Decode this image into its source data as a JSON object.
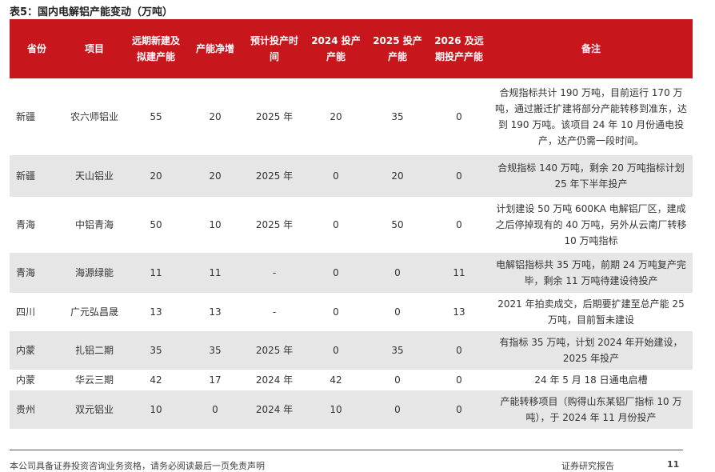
{
  "title": "表5：国内电解铝产能变动（万吨）",
  "headers": [
    "省份",
    "项目",
    "远期新建及拟建产能",
    "产能净增",
    "预计投产时间",
    "2024 投产产能",
    "2025 投产产能",
    "2026 及远期投产产能",
    "备注"
  ],
  "rows": [
    [
      "新疆",
      "农六师铝业",
      "55",
      "20",
      "2025 年",
      "20",
      "35",
      "0",
      "合规指标共计 190 万吨，目前运行 170 万吨，通过搬迁扩建将部分产能转移到准东，达到 190 万吨。该项目 24 年 10 月份通电投产，达产仍需一段时间。"
    ],
    [
      "新疆",
      "天山铝业",
      "20",
      "20",
      "2025 年",
      "0",
      "20",
      "0",
      "合规指标 140 万吨，剩余 20 万吨指标计划 25 年下半年投产"
    ],
    [
      "青海",
      "中铝青海",
      "50",
      "10",
      "2025 年",
      "0",
      "50",
      "0",
      "计划建设 50 万吨 600KA 电解铝厂区，建成之后停掉现有的 40 万吨，另外从云南厂转移 10 万吨指标"
    ],
    [
      "青海",
      "海源绿能",
      "11",
      "11",
      "-",
      "0",
      "0",
      "11",
      "电解铝指标共 35 万吨，前期 24 万吨复产完毕，剩余 11 万吨待建设待投产"
    ],
    [
      "四川",
      "广元弘昌晟",
      "13",
      "13",
      "-",
      "0",
      "0",
      "13",
      "2021 年拍卖成交，后期要扩建至总产能 25 万吨，目前暂未建设"
    ],
    [
      "内蒙",
      "扎铝二期",
      "35",
      "35",
      "2025 年",
      "0",
      "35",
      "0",
      "有指标 35 万吨，计划 2024 年开始建设，2025 年投产"
    ],
    [
      "内蒙",
      "华云三期",
      "42",
      "17",
      "2024 年",
      "42",
      "0",
      "0",
      "24 年 5 月 18 日通电启槽"
    ],
    [
      "贵州",
      "双元铝业",
      "10",
      "0",
      "2024 年",
      "10",
      "0",
      "0",
      "产能转移项目（购得山东某铝厂指标 10 万吨），于 2024 年 11 月份投产"
    ]
  ],
  "footer": {
    "disclaimer": "本公司具备证券投资咨询业务资格，请务必阅读最后一页免责声明",
    "report_type": "证券研究报告",
    "page": "11"
  }
}
